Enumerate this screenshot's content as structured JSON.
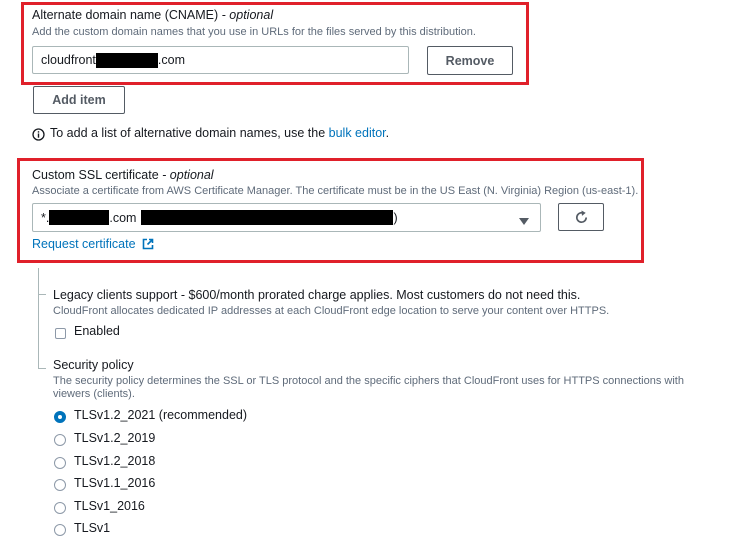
{
  "cname": {
    "label": "Alternate domain name (CNAME)",
    "optional": "- optional",
    "description": "Add the custom domain names that you use in URLs for the files served by this distribution.",
    "value_prefix": "cloudfront",
    "value_suffix": ".com",
    "remove_label": "Remove",
    "add_item_label": "Add item"
  },
  "info": {
    "text": "To add a list of alternative domain names, use the",
    "link": "bulk editor",
    "suffix": "."
  },
  "ssl": {
    "label": "Custom SSL certificate",
    "optional": "- optional",
    "description": "Associate a certificate from AWS Certificate Manager. The certificate must be in the US East (N. Virginia) Region (us-east-1).",
    "value_prefix": "*.",
    "value_mid": ".com",
    "value_suffix": ")",
    "request_link": "Request certificate"
  },
  "legacy": {
    "label": "Legacy clients support - $600/month prorated charge applies. Most customers do not need this.",
    "description": "CloudFront allocates dedicated IP addresses at each CloudFront edge location to serve your content over HTTPS.",
    "enabled_label": "Enabled"
  },
  "security_policy": {
    "label": "Security policy",
    "description_line1": "The security policy determines the SSL or TLS protocol and the specific ciphers that CloudFront uses for HTTPS connections with",
    "description_line2": "viewers (clients).",
    "options": [
      "TLSv1.2_2021 (recommended)",
      "TLSv1.2_2019",
      "TLSv1.2_2018",
      "TLSv1.1_2016",
      "TLSv1_2016",
      "TLSv1"
    ],
    "selected": "TLSv1.2_2021 (recommended)"
  },
  "colors": {
    "highlight": "#e0202a",
    "link": "#0073bb",
    "selected_radio": "#0073bb"
  }
}
